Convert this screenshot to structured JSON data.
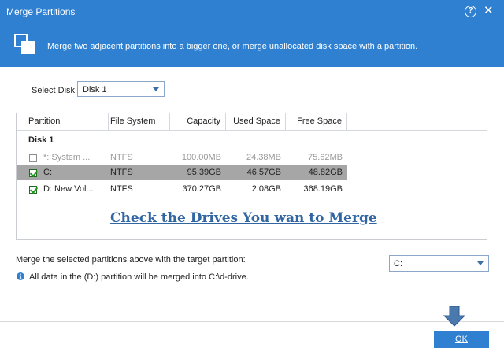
{
  "window": {
    "title": "Merge Partitions",
    "help_icon": "question-circle-icon",
    "help_glyph": "?",
    "close_icon": "close-icon",
    "close_glyph": "✕"
  },
  "banner": {
    "icon": "merge-partitions-icon",
    "description": "Merge two adjacent partitions into a bigger one, or merge unallocated disk space with a partition."
  },
  "disk_selector": {
    "label": "Select Disk:",
    "value": "Disk 1"
  },
  "table": {
    "columns": [
      "Partition",
      "File System",
      "Capacity",
      "Used Space",
      "Free Space"
    ],
    "group": "Disk 1",
    "rows": [
      {
        "checked": false,
        "partition": "*: System ...",
        "file_system": "NTFS",
        "capacity": "100.00MB",
        "used": "24.38MB",
        "free": "75.62MB",
        "dimmed": true
      },
      {
        "checked": true,
        "partition": "C:",
        "file_system": "NTFS",
        "capacity": "95.39GB",
        "used": "46.57GB",
        "free": "48.82GB",
        "selected": true
      },
      {
        "checked": true,
        "partition": "D:  New Vol...",
        "file_system": "NTFS",
        "capacity": "370.27GB",
        "used": "2.08GB",
        "free": "368.19GB"
      }
    ]
  },
  "annotation": "Check the Drives You wan to Merge",
  "target": {
    "label": "Merge the selected partitions above with the target partition:",
    "value": "C:"
  },
  "info": {
    "icon": "info-icon",
    "glyph": "i",
    "text": "All data in the (D:) partition will be merged into C:\\d-drive."
  },
  "ok_label": "OK",
  "colors": {
    "accent": "#2f80d0",
    "selected_row": "#a6a6a6",
    "annotation": "#3166a3"
  }
}
